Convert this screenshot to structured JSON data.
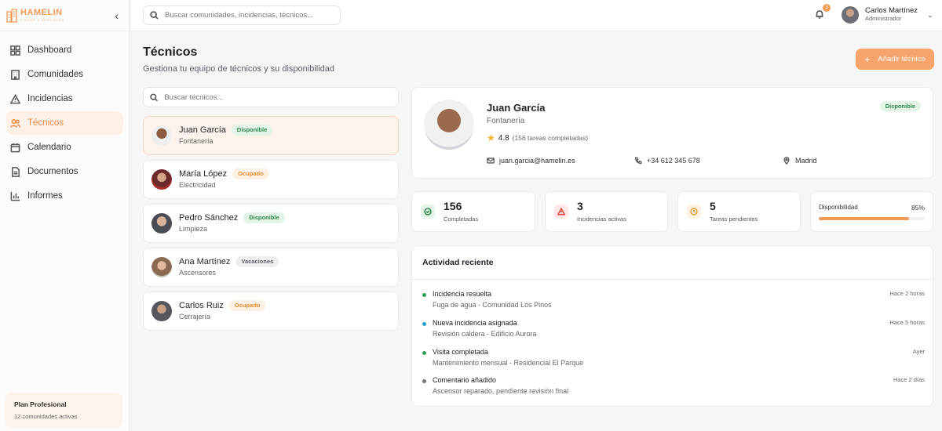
{
  "brand": {
    "name": "HAMELIN",
    "tagline": "FINCAS & SERVICIOS"
  },
  "sidebar": {
    "items": [
      {
        "label": "Dashboard",
        "icon": "grid-icon"
      },
      {
        "label": "Comunidades",
        "icon": "building-icon"
      },
      {
        "label": "Incidencias",
        "icon": "warning-icon"
      },
      {
        "label": "Técnicos",
        "icon": "users-icon",
        "active": true
      },
      {
        "label": "Calendario",
        "icon": "calendar-icon"
      },
      {
        "label": "Documentos",
        "icon": "document-icon"
      },
      {
        "label": "Informes",
        "icon": "chart-icon"
      }
    ],
    "plan": {
      "title": "Plan Profesional",
      "subtitle": "12 comunidades activas"
    }
  },
  "header": {
    "search_placeholder": "Buscar comunidades, incidencias, técnicos...",
    "notifications": "3",
    "user": {
      "name": "Carlos Martínez",
      "role": "Administrador"
    }
  },
  "page": {
    "title": "Técnicos",
    "subtitle": "Gestiona tu equipo de técnicos y su disponibilidad",
    "add_button": "Añadir técnico"
  },
  "list": {
    "search_placeholder": "Buscar técnicos...",
    "technicians": [
      {
        "name": "Juan García",
        "specialty": "Fontanería",
        "status": "Disponible"
      },
      {
        "name": "María López",
        "specialty": "Electricidad",
        "status": "Ocupado"
      },
      {
        "name": "Pedro Sánchez",
        "specialty": "Limpieza",
        "status": "Disponible"
      },
      {
        "name": "Ana Martínez",
        "specialty": "Ascensores",
        "status": "Vacaciones"
      },
      {
        "name": "Carlos Ruiz",
        "specialty": "Cerrajería",
        "status": "Ocupado"
      }
    ]
  },
  "profile": {
    "name": "Juan García",
    "specialty": "Fontanería",
    "rating": "4.8",
    "rating_detail": "(156 tareas completadas)",
    "status": "Disponible",
    "email": "juan.garcia@hamelin.es",
    "phone": "+34 612 345 678",
    "location": "Madrid"
  },
  "stats": {
    "completed": {
      "value": "156",
      "label": "Completadas"
    },
    "active": {
      "value": "3",
      "label": "Incidencias activas"
    },
    "pending": {
      "value": "5",
      "label": "Tareas pendientes"
    },
    "availability": {
      "label": "Disponibilidad",
      "value": "85%",
      "fraction": 0.85
    }
  },
  "activity": {
    "title": "Actividad reciente",
    "items": [
      {
        "title": "Incidencia resuelta",
        "detail": "Fuga de agua - Comunidad Los Pinos",
        "time": "Hace 2 horas",
        "color": "#2f9e57"
      },
      {
        "title": "Nueva incidencia asignada",
        "detail": "Revisión caldera - Edificio Aurora",
        "time": "Hace 5 horas",
        "color": "#22a4c9"
      },
      {
        "title": "Visita completada",
        "detail": "Mantenimiento mensual - Residencial El Parque",
        "time": "Ayer",
        "color": "#2f9e57"
      },
      {
        "title": "Comentario añadido",
        "detail": "Ascensor reparado, pendiente revisión final",
        "time": "Hace 2 días",
        "color": "#777777"
      }
    ]
  },
  "colors": {
    "accent": "#f29a56",
    "green": "#2f8a4e",
    "orange": "#e08c34"
  }
}
